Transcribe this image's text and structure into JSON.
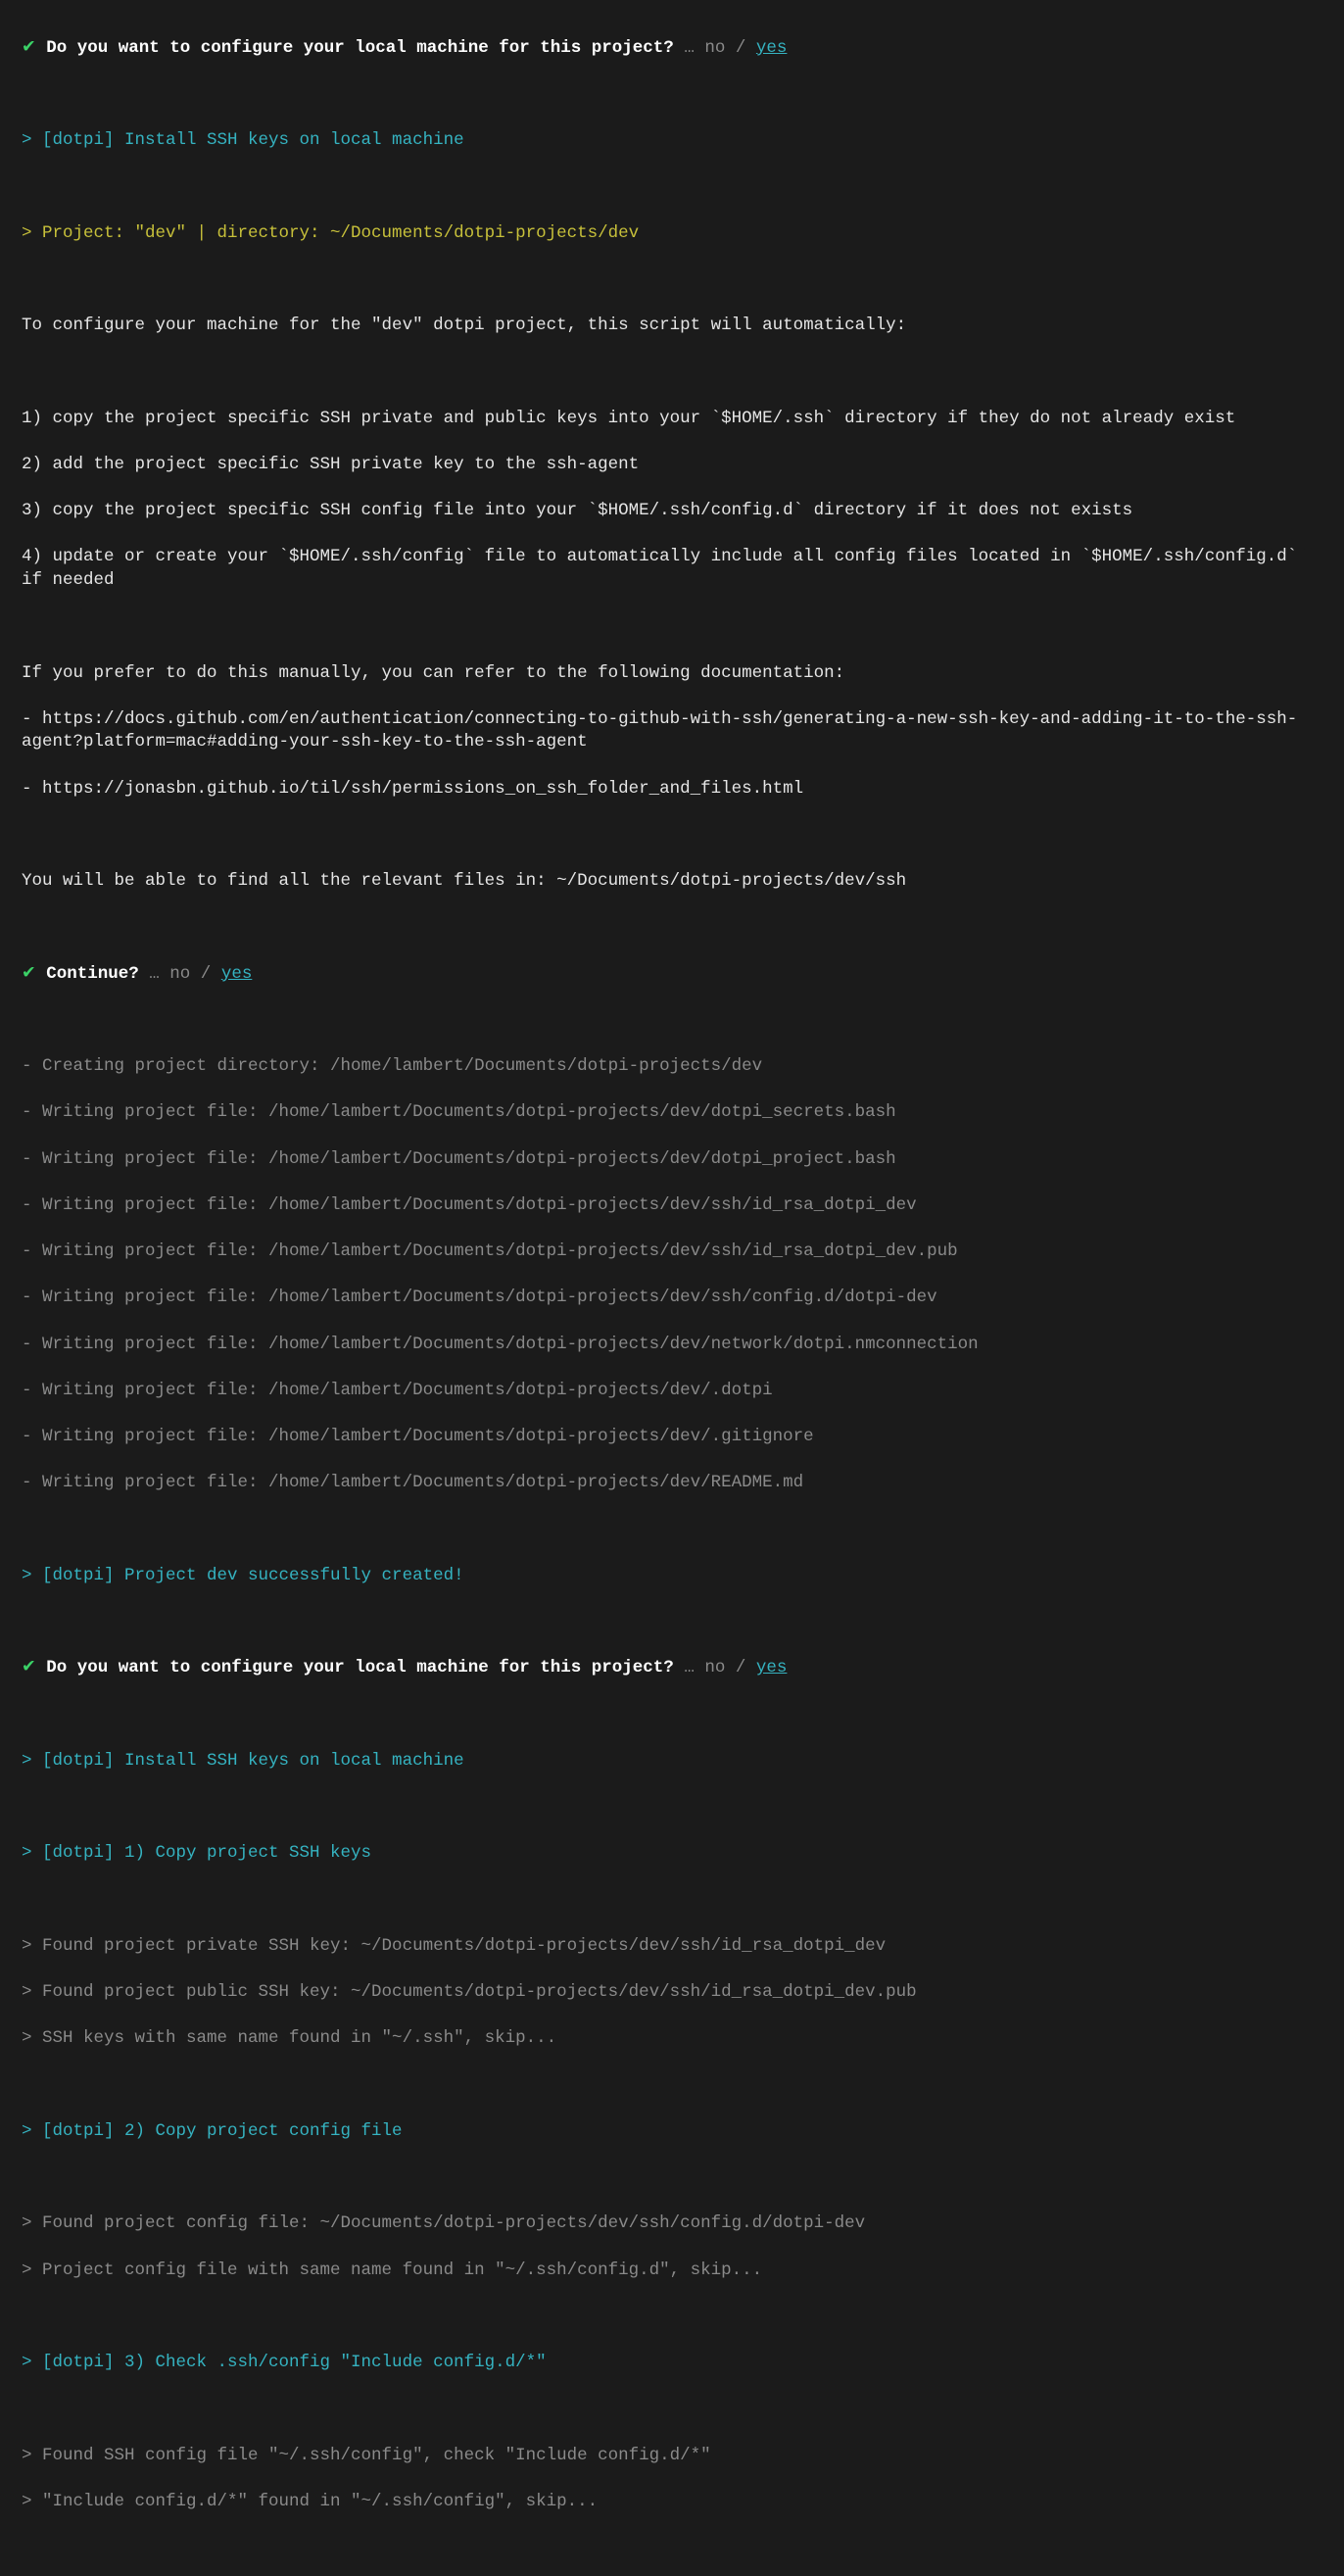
{
  "prompt1": {
    "check": "✔",
    "question": "Do you want to configure your local machine for this project?",
    "ellipsis": "…",
    "no": "no",
    "slash": "/",
    "yes": "yes"
  },
  "install1": "> [dotpi] Install SSH keys on local machine",
  "projectLine": "> Project: \"dev\" | directory: ~/Documents/dotpi-projects/dev",
  "intro": "To configure your machine for the \"dev\" dotpi project, this script will automatically:",
  "step1": "1) copy the project specific SSH private and public keys into your `$HOME/.ssh` directory if they do not already exist",
  "step2": "2) add the project specific SSH private key to the ssh-agent",
  "step3": "3) copy the project specific SSH config file into your `$HOME/.ssh/config.d` directory if it does not exists",
  "step4": "4) update or create your `$HOME/.ssh/config` file to automatically include all config files located in `$HOME/.ssh/config.d` if needed",
  "manualIntro": "If you prefer to do this manually, you can refer to the following documentation:",
  "doc1": "- https://docs.github.com/en/authentication/connecting-to-github-with-ssh/generating-a-new-ssh-key-and-adding-it-to-the-ssh-agent?platform=mac#adding-your-ssh-key-to-the-ssh-agent",
  "doc2": "- https://jonasbn.github.io/til/ssh/permissions_on_ssh_folder_and_files.html",
  "filesNote": "You will be able to find all the relevant files in: ~/Documents/dotpi-projects/dev/ssh",
  "prompt2": {
    "check": "✔",
    "question": "Continue?",
    "ellipsis": "…",
    "no": "no",
    "slash": "/",
    "yes": "yes"
  },
  "writes": [
    "- Creating project directory: /home/lambert/Documents/dotpi-projects/dev",
    "- Writing project file: /home/lambert/Documents/dotpi-projects/dev/dotpi_secrets.bash",
    "- Writing project file: /home/lambert/Documents/dotpi-projects/dev/dotpi_project.bash",
    "- Writing project file: /home/lambert/Documents/dotpi-projects/dev/ssh/id_rsa_dotpi_dev",
    "- Writing project file: /home/lambert/Documents/dotpi-projects/dev/ssh/id_rsa_dotpi_dev.pub",
    "- Writing project file: /home/lambert/Documents/dotpi-projects/dev/ssh/config.d/dotpi-dev",
    "- Writing project file: /home/lambert/Documents/dotpi-projects/dev/network/dotpi.nmconnection",
    "- Writing project file: /home/lambert/Documents/dotpi-projects/dev/.dotpi",
    "- Writing project file: /home/lambert/Documents/dotpi-projects/dev/.gitignore",
    "- Writing project file: /home/lambert/Documents/dotpi-projects/dev/README.md"
  ],
  "created": "> [dotpi] Project dev successfully created!",
  "prompt3": {
    "check": "✔",
    "question": "Do you want to configure your local machine for this project?",
    "ellipsis": "…",
    "no": "no",
    "slash": "/",
    "yes": "yes"
  },
  "install2": "> [dotpi] Install SSH keys on local machine",
  "copyKeysHeader": "> [dotpi] 1) Copy project SSH keys",
  "copyKeysOut": [
    "> Found project private SSH key: ~/Documents/dotpi-projects/dev/ssh/id_rsa_dotpi_dev",
    "> Found project public SSH key: ~/Documents/dotpi-projects/dev/ssh/id_rsa_dotpi_dev.pub",
    "> SSH keys with same name found in \"~/.ssh\", skip..."
  ],
  "copyConfigHeader": "> [dotpi] 2) Copy project config file",
  "copyConfigOut": [
    "> Found project config file: ~/Documents/dotpi-projects/dev/ssh/config.d/dotpi-dev",
    "> Project config file with same name found in \"~/.ssh/config.d\", skip..."
  ],
  "checkHeader": "> [dotpi] 3) Check .ssh/config \"Include config.d/*\"",
  "checkOut": [
    "> Found SSH config file \"~/.ssh/config\", check \"Include config.d/*\"",
    "> \"Include config.d/*\" found in \"~/.ssh/config\", skip..."
  ]
}
